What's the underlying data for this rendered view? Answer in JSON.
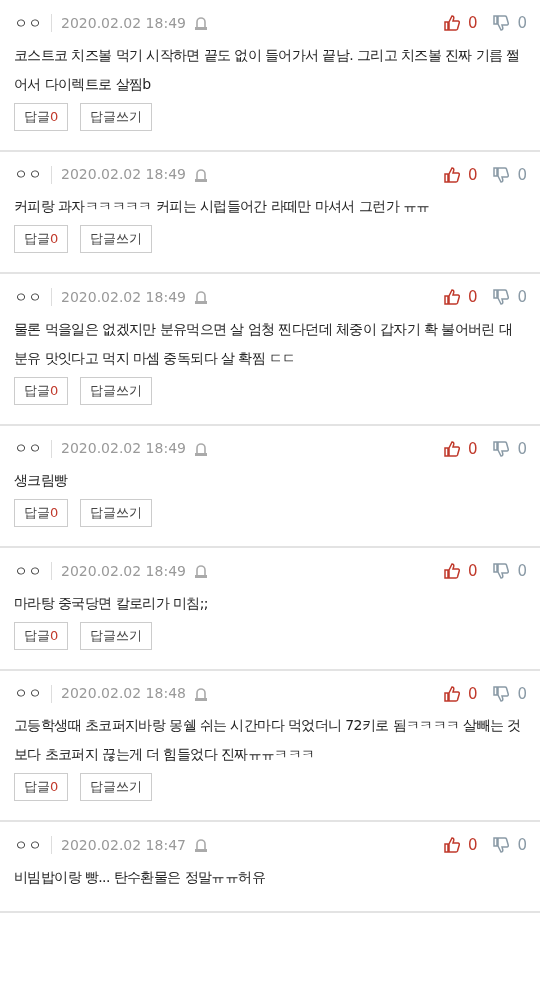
{
  "comments": [
    {
      "author": "ㅇㅇ",
      "date": "2020.02.02 18:49",
      "likes": "0",
      "dislikes": "0",
      "text": "코스트코 치즈볼 먹기 시작하면 끝도 없이 들어가서 끝남. 그리고 치즈볼 진짜 기름 쩔어서 다이렉트로 살찜b",
      "reply_label": "답글",
      "reply_count": "0",
      "write_label": "답글쓰기"
    },
    {
      "author": "ㅇㅇ",
      "date": "2020.02.02 18:49",
      "likes": "0",
      "dislikes": "0",
      "text": "커피랑 과자ㅋㅋㅋㅋㅋ 커피는 시럽들어간 라떼만 마셔서 그런가 ㅠㅠ",
      "reply_label": "답글",
      "reply_count": "0",
      "write_label": "답글쓰기"
    },
    {
      "author": "ㅇㅇ",
      "date": "2020.02.02 18:49",
      "likes": "0",
      "dislikes": "0",
      "text": "물론 먹을일은 없겠지만 분유먹으면 살 엄청 찐다던데 체중이 갑자기 확 불어버린 대 분유 맛잇다고 먹지 마셈 중독되다 살 확찜 ㄷㄷ",
      "reply_label": "답글",
      "reply_count": "0",
      "write_label": "답글쓰기"
    },
    {
      "author": "ㅇㅇ",
      "date": "2020.02.02 18:49",
      "likes": "0",
      "dislikes": "0",
      "text": "생크림빵",
      "reply_label": "답글",
      "reply_count": "0",
      "write_label": "답글쓰기"
    },
    {
      "author": "ㅇㅇ",
      "date": "2020.02.02 18:49",
      "likes": "0",
      "dislikes": "0",
      "text": "마라탕 중국당면 칼로리가 미침;;",
      "reply_label": "답글",
      "reply_count": "0",
      "write_label": "답글쓰기"
    },
    {
      "author": "ㅇㅇ",
      "date": "2020.02.02 18:48",
      "likes": "0",
      "dislikes": "0",
      "text": "고등학생때 초코퍼지바랑 몽쉘 쉬는 시간마다 먹었더니 72키로 됨ㅋㅋㅋㅋ 살빼는 것보다 초코퍼지 끊는게 더 힘들었다 진짜ㅠㅠㅋㅋㅋ",
      "reply_label": "답글",
      "reply_count": "0",
      "write_label": "답글쓰기"
    },
    {
      "author": "ㅇㅇ",
      "date": "2020.02.02 18:47",
      "likes": "0",
      "dislikes": "0",
      "text": "비빔밥이랑 빵... 탄수환물은 정말ㅠㅠ허유"
    }
  ]
}
